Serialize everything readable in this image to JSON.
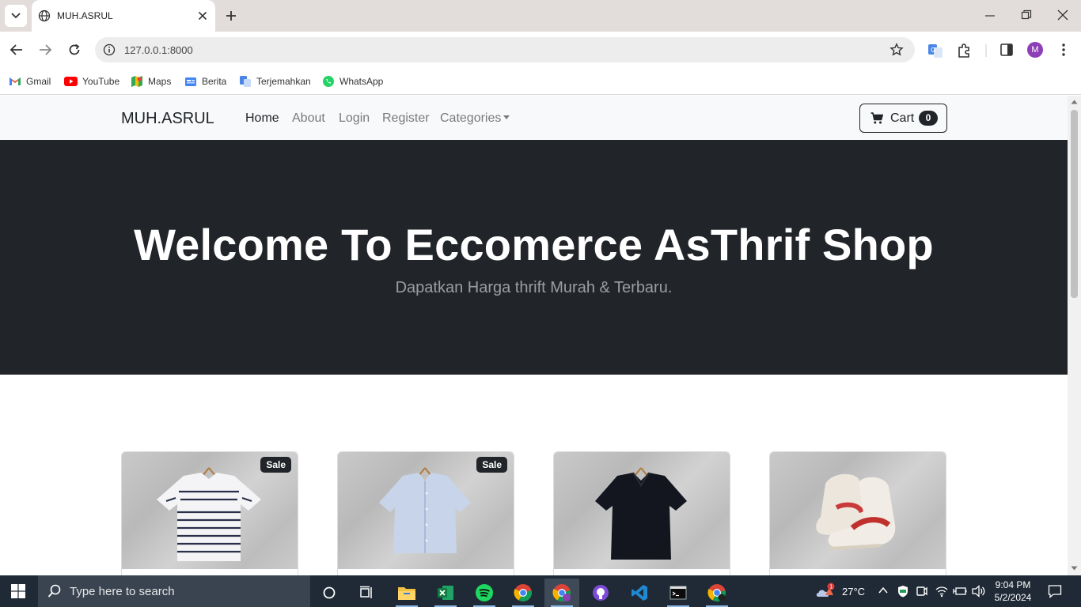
{
  "browser": {
    "tab_title": "MUH.ASRUL",
    "url": "127.0.0.1:8000",
    "profile_initial": "M",
    "bookmarks": [
      {
        "label": "Gmail",
        "icon": "gmail-icon"
      },
      {
        "label": "YouTube",
        "icon": "youtube-icon"
      },
      {
        "label": "Maps",
        "icon": "maps-icon"
      },
      {
        "label": "Berita",
        "icon": "news-icon"
      },
      {
        "label": "Terjemahkan",
        "icon": "translate-icon"
      },
      {
        "label": "WhatsApp",
        "icon": "whatsapp-icon"
      }
    ]
  },
  "site": {
    "brand": "MUH.ASRUL",
    "nav": [
      {
        "label": "Home",
        "active": true
      },
      {
        "label": "About",
        "active": false
      },
      {
        "label": "Login",
        "active": false
      },
      {
        "label": "Register",
        "active": false
      },
      {
        "label": "Categories",
        "active": false,
        "dropdown": true
      }
    ],
    "cart": {
      "label": "Cart",
      "count": "0"
    },
    "hero": {
      "title": "Welcome To Eccomerce AsThrif Shop",
      "subtitle": "Dapatkan Harga thrift Murah & Terbaru."
    },
    "products": [
      {
        "image": "striped white polo shirt",
        "badge": "Sale"
      },
      {
        "image": "light blue button shirt",
        "badge": "Sale"
      },
      {
        "image": "navy polo shirt",
        "badge": ""
      },
      {
        "image": "white red high-top sneakers",
        "badge": ""
      }
    ]
  },
  "taskbar": {
    "search_placeholder": "Type here to search",
    "weather": "27°C",
    "weather_badge": "1",
    "time": "9:04 PM",
    "date": "5/2/2024"
  },
  "colors": {
    "hero_bg": "#212529",
    "nav_bg": "#f8f9fa",
    "tabstrip_bg": "#e2dddb",
    "taskbar_bg": "#1f2a36"
  }
}
